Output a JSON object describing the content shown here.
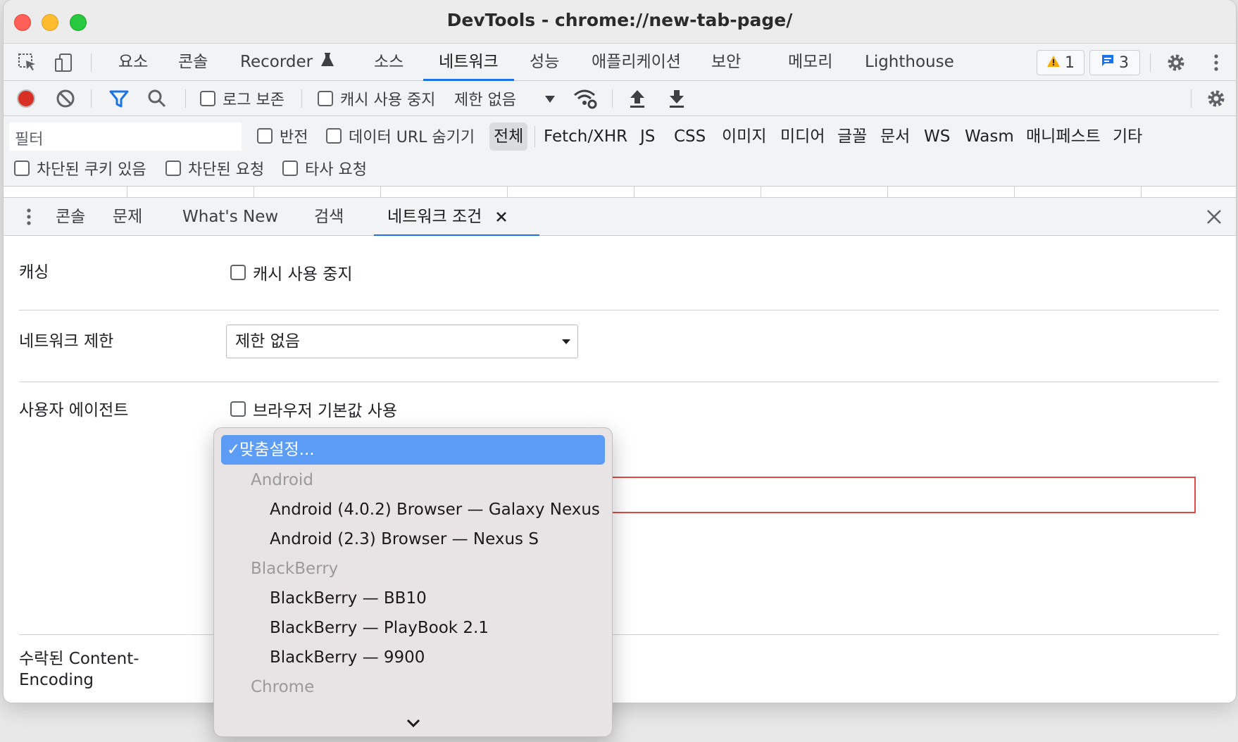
{
  "window": {
    "title": "DevTools - chrome://new-tab-page/"
  },
  "main_tabs": [
    {
      "label": "요소"
    },
    {
      "label": "콘솔"
    },
    {
      "label": "Recorder"
    },
    {
      "label": "소스"
    },
    {
      "label": "네트워크",
      "active": true
    },
    {
      "label": "성능"
    },
    {
      "label": "애플리케이션"
    },
    {
      "label": "보안"
    },
    {
      "label": "메모리"
    },
    {
      "label": "Lighthouse"
    }
  ],
  "badges": {
    "warnings": "1",
    "messages": "3"
  },
  "toolbar": {
    "preserve_log": "로그 보존",
    "disable_cache": "캐시 사용 중지",
    "throttling": "제한 없음"
  },
  "filter": {
    "placeholder": "필터",
    "invert": "반전",
    "hide_data_urls": "데이터 URL 숨기기",
    "types": [
      "전체",
      "Fetch/XHR",
      "JS",
      "CSS",
      "이미지",
      "미디어",
      "글꼴",
      "문서",
      "WS",
      "Wasm",
      "매니페스트",
      "기타"
    ],
    "blocked_cookies": "차단된 쿠키 있음",
    "blocked_requests": "차단된 요청",
    "third_party": "타사 요청"
  },
  "drawer_tabs": [
    {
      "label": "콘솔"
    },
    {
      "label": "문제"
    },
    {
      "label": "What's New"
    },
    {
      "label": "검색"
    },
    {
      "label": "네트워크 조건",
      "active": true
    }
  ],
  "conditions": {
    "caching_label": "캐싱",
    "disable_cache": "캐시 사용 중지",
    "throttling_label": "네트워크 제한",
    "throttling_value": "제한 없음",
    "ua_label": "사용자 에이전트",
    "ua_default": "브라우저 기본값 사용",
    "encodings_label_1": "수락된 Content-",
    "encodings_label_2": "Encoding"
  },
  "dropdown": {
    "selected": "맞춤설정...",
    "group_android": "Android",
    "android_1": "Android (4.0.2) Browser — Galaxy Nexus",
    "android_2": "Android (2.3) Browser — Nexus S",
    "group_blackberry": "BlackBerry",
    "bb_1": "BlackBerry — BB10",
    "bb_2": "BlackBerry — PlayBook 2.1",
    "bb_3": "BlackBerry — 9900",
    "group_chrome": "Chrome"
  }
}
